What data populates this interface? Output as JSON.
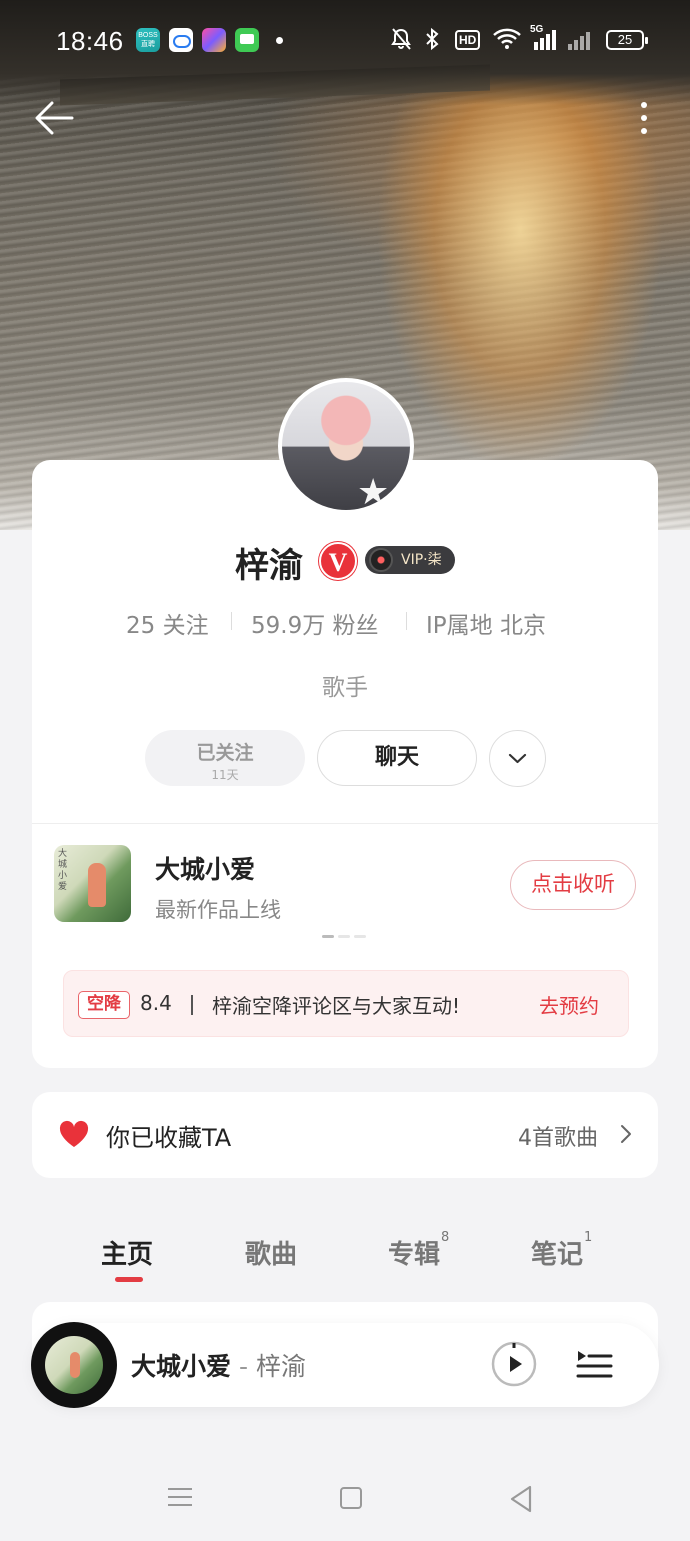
{
  "status_bar": {
    "time": "18:46",
    "app_icon_boss": "BOSS\n直聘",
    "battery": "25",
    "icons": [
      "boss-app-icon",
      "baidu-netdisk-icon",
      "shortcut-app-icon",
      "messages-icon",
      "mute-icon",
      "bluetooth-icon",
      "hd-icon",
      "wifi-icon",
      "signal-5g-icon",
      "signal-icon",
      "battery-icon"
    ]
  },
  "nav": {
    "back_icon": "arrow-left-icon",
    "more_icon": "more-vertical-icon"
  },
  "profile": {
    "name": "梓渝",
    "verified_badge": "V",
    "vip_label": "VIP·柒",
    "following": "25 关注",
    "followers": "59.9万 粉丝",
    "ip_location": "IP属地 北京",
    "role": "歌手",
    "followed_label": "已关注",
    "followed_days": "11天",
    "chat_label": "聊天"
  },
  "new_release": {
    "title": "大城小爱",
    "subtitle": "最新作品上线",
    "action": "点击收听",
    "cover_text": "大城小爱"
  },
  "notice": {
    "tag": "空降",
    "date": "8.4",
    "message": "梓渝空降评论区与大家互动!",
    "action": "去预约"
  },
  "collection": {
    "label": "你已收藏TA",
    "count": "4首歌曲"
  },
  "tabs": [
    {
      "label": "主页",
      "badge": ""
    },
    {
      "label": "歌曲",
      "badge": ""
    },
    {
      "label": "专辑",
      "badge": "8"
    },
    {
      "label": "笔记",
      "badge": "1"
    }
  ],
  "player": {
    "song": "大城小爱",
    "separator": " - ",
    "artist": "梓渝"
  },
  "colors": {
    "accent_red": "#e33c43",
    "vip_dark": "#3b3b3e",
    "page_bg": "#f3f3f5"
  }
}
